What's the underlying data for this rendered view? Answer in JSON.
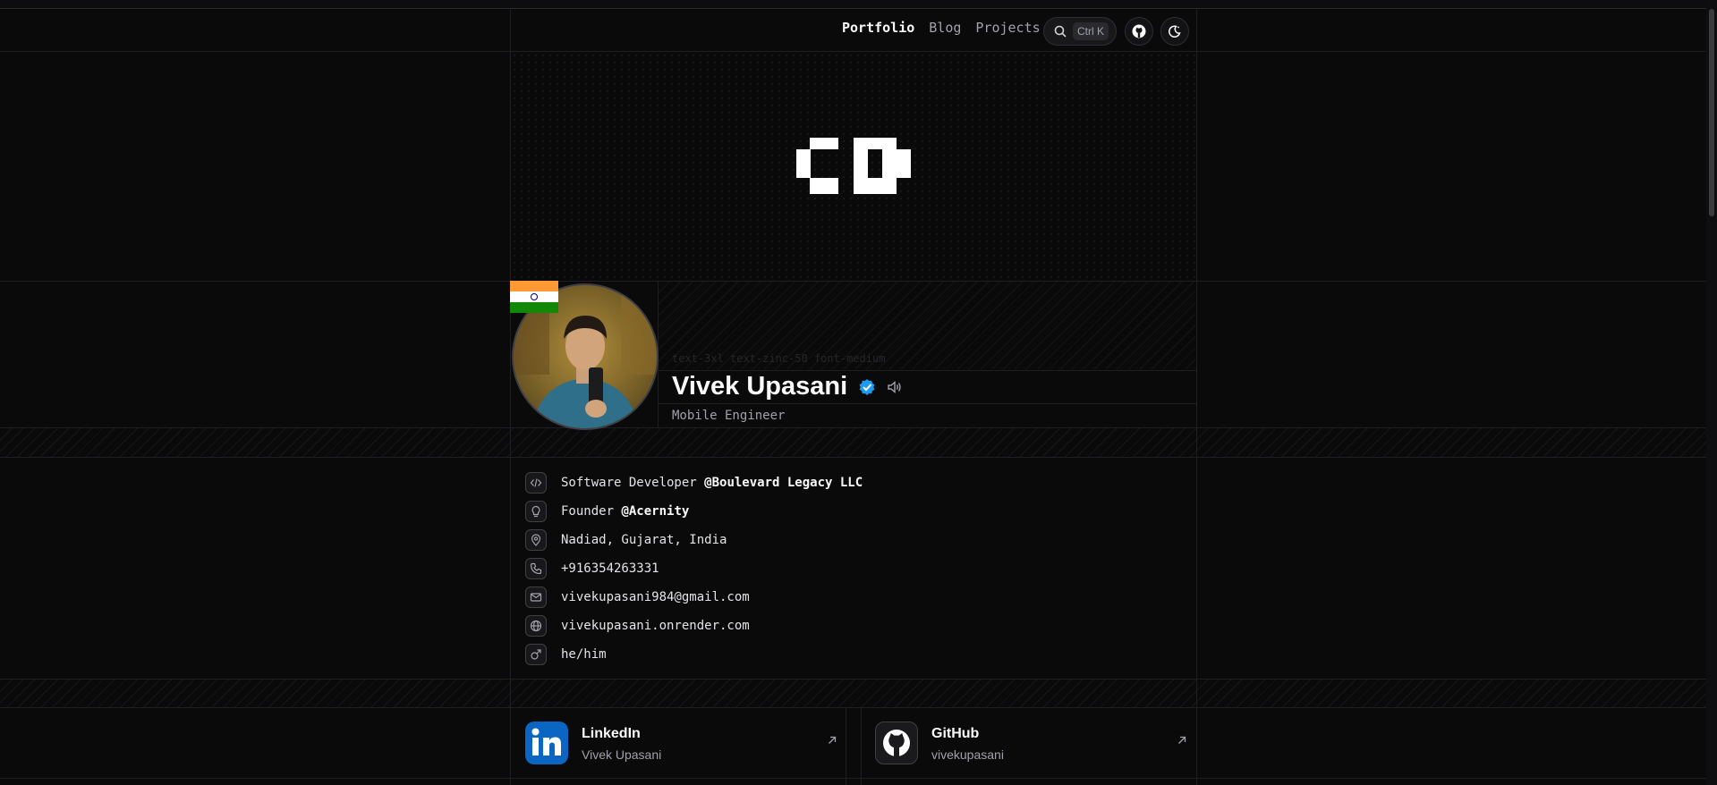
{
  "nav": {
    "items": [
      {
        "label": "Portfolio",
        "active": true
      },
      {
        "label": "Blog",
        "active": false
      },
      {
        "label": "Projects",
        "active": false
      }
    ],
    "search_shortcut": "Ctrl K"
  },
  "profile": {
    "ghost_text": "text-3xl text-zinc-50 font-medium",
    "name": "Vivek Upasani",
    "role": "Mobile Engineer",
    "flag": "India"
  },
  "info": {
    "job_prefix": "Software Developer ",
    "job_company": "@Boulevard Legacy LLC",
    "founder_prefix": "Founder ",
    "founder_company": "@Acernity",
    "location": "Nadiad, Gujarat, India",
    "phone": "+916354263331",
    "email": "vivekupasani984@gmail.com",
    "website": "vivekupasani.onrender.com",
    "pronouns": "he/him"
  },
  "socials": [
    {
      "name": "LinkedIn",
      "handle": "Vivek Upasani",
      "color": "#0a66c2"
    },
    {
      "name": "GitHub",
      "handle": "vivekupasani",
      "color": "#1a1a1d"
    }
  ],
  "colors": {
    "background": "#0a0a0b",
    "verified": "#1d9bf0",
    "text": "#fafafa",
    "muted": "#a1a1aa"
  }
}
